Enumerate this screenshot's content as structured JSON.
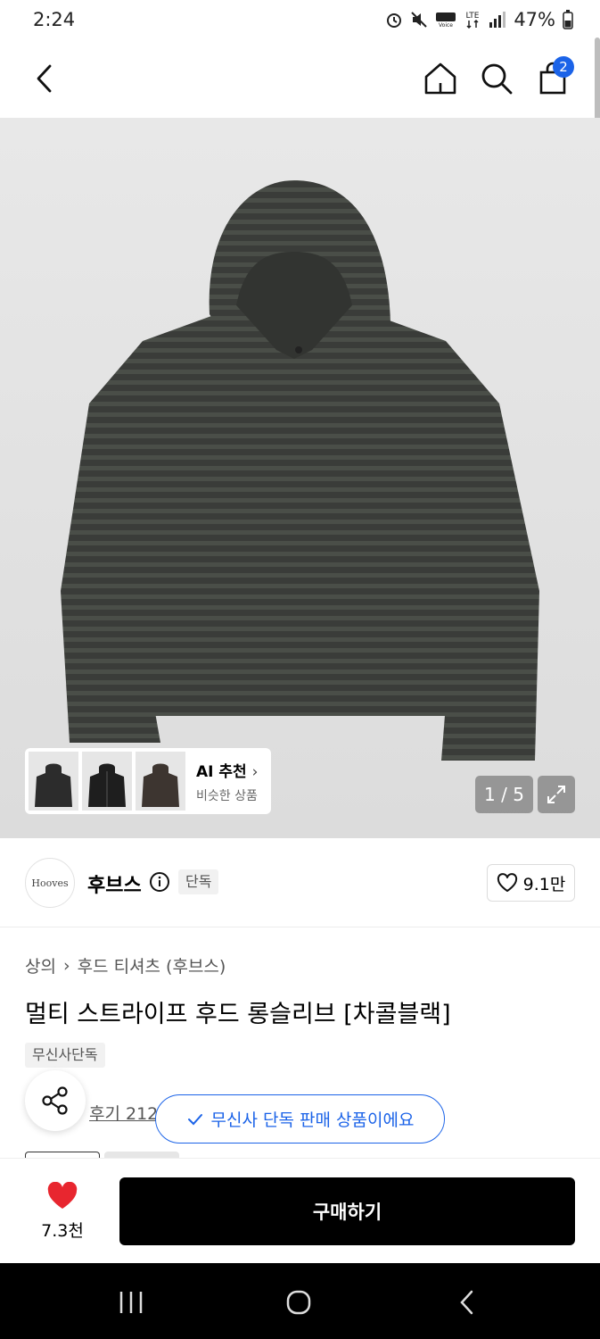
{
  "status": {
    "time": "2:24",
    "battery": "47%"
  },
  "nav": {
    "cart_count": "2"
  },
  "gallery": {
    "ai_title": "AI 추천",
    "ai_subtitle": "비슷한 상품",
    "pager": "1 / 5"
  },
  "brand": {
    "logo_text": "Hooves",
    "name": "후브스",
    "exclusive_tag": "단독",
    "likes": "9.1만"
  },
  "product": {
    "breadcrumb": [
      "상의",
      "후드 티셔츠 (후브스)"
    ],
    "title": "멀티 스트라이프 후드 롱슬리브 [차콜블랙]",
    "tag": "무신사단독",
    "review": "후기 212"
  },
  "toast": {
    "text": "무신사 단독 판매 상품이에요"
  },
  "action": {
    "wish_count": "7.3천",
    "buy_label": "구매하기"
  },
  "colors": {
    "accent": "#1b63e8",
    "heart": "#e8262f",
    "buy": "#000000"
  }
}
